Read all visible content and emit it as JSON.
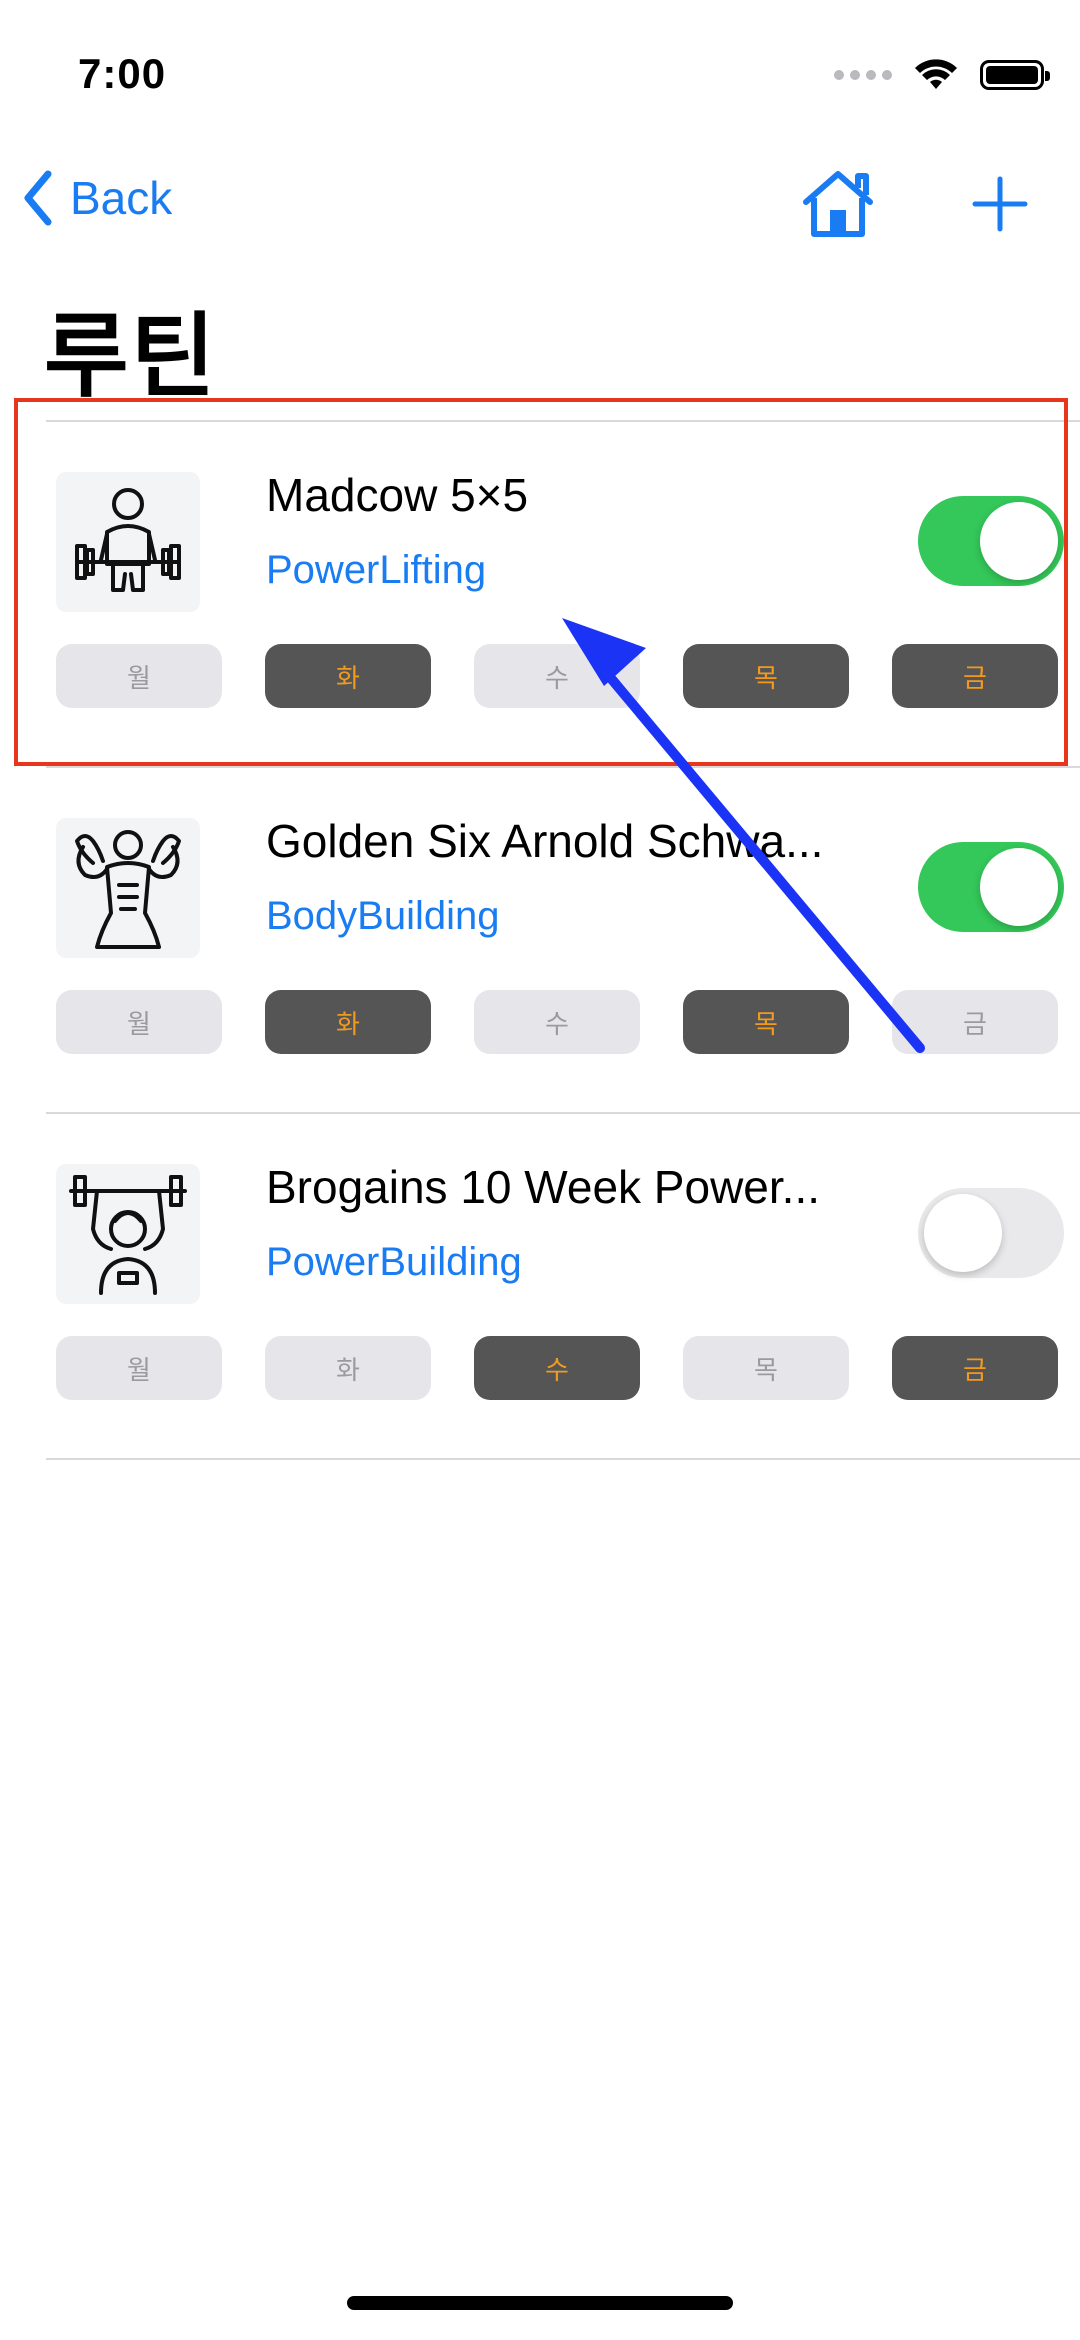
{
  "status_bar": {
    "time": "7:00"
  },
  "nav": {
    "back_label": "Back"
  },
  "page": {
    "title": "루틴"
  },
  "routines": [
    {
      "name": "Madcow 5×5",
      "category": "PowerLifting",
      "icon": "weightlifter-deadlift-icon",
      "enabled": true,
      "days": [
        {
          "label": "월",
          "active": false
        },
        {
          "label": "화",
          "active": true
        },
        {
          "label": "수",
          "active": false
        },
        {
          "label": "목",
          "active": true
        },
        {
          "label": "금",
          "active": true
        }
      ]
    },
    {
      "name": "Golden Six Arnold Schwa...",
      "category": "BodyBuilding",
      "icon": "bodybuilder-flex-icon",
      "enabled": true,
      "days": [
        {
          "label": "월",
          "active": false
        },
        {
          "label": "화",
          "active": true
        },
        {
          "label": "수",
          "active": false
        },
        {
          "label": "목",
          "active": true
        },
        {
          "label": "금",
          "active": false
        }
      ]
    },
    {
      "name": "Brogains 10 Week Power...",
      "category": "PowerBuilding",
      "icon": "overhead-press-icon",
      "enabled": false,
      "days": [
        {
          "label": "월",
          "active": false
        },
        {
          "label": "화",
          "active": false
        },
        {
          "label": "수",
          "active": true
        },
        {
          "label": "목",
          "active": false
        },
        {
          "label": "금",
          "active": true
        }
      ]
    }
  ],
  "colors": {
    "accent": "#1a7cf2",
    "toggle_on": "#34c759",
    "day_active_bg": "#555555",
    "day_active_text": "#f29a1d",
    "highlight_box": "#e8361c",
    "annotation_arrow": "#1a33f5"
  }
}
